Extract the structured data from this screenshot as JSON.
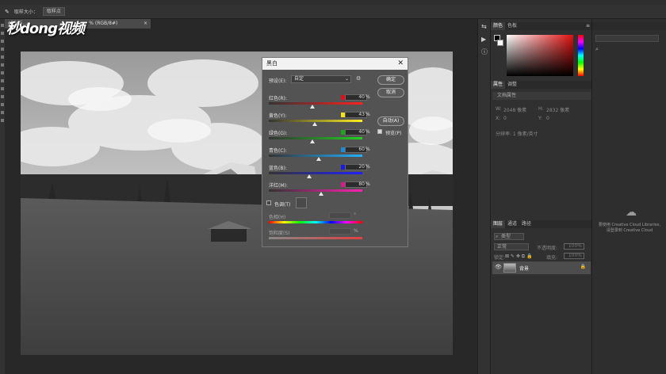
{
  "options_bar": {
    "size_label": "取样大小：",
    "size_value": "取样点"
  },
  "doc_tab": {
    "title": "c83d5...",
    "mode_suffix": "% (RGB/8#)"
  },
  "watermark": {
    "text": "秒dong视频"
  },
  "dialog": {
    "title": "黑白",
    "preset_label": "预设(E):",
    "preset_value": "自定",
    "ok_label": "确定",
    "cancel_label": "取消",
    "auto_label": "自动(A)",
    "preview_label": "预览(P)",
    "preview_checked": true,
    "sliders": [
      {
        "label": "红色(R):",
        "value": "40",
        "swatch": "#e0101a",
        "pos": 0.47
      },
      {
        "label": "黄色(Y):",
        "value": "43",
        "swatch": "#f2e31a",
        "pos": 0.49
      },
      {
        "label": "绿色(G):",
        "value": "40",
        "swatch": "#1aa81a",
        "pos": 0.47
      },
      {
        "label": "青色(C):",
        "value": "60",
        "swatch": "#1a8cd8",
        "pos": 0.53
      },
      {
        "label": "蓝色(B):",
        "value": "20",
        "swatch": "#1a1ae0",
        "pos": 0.43
      },
      {
        "label": "洋红(M):",
        "value": "80",
        "swatch": "#d81a8c",
        "pos": 0.56
      }
    ],
    "pct_sign": "%",
    "tint_label": "色调(T)",
    "hue_label": "色相(H)",
    "hue_unit": "°",
    "saturation_label": "饱和度(S)"
  },
  "color_panel": {
    "tab1": "颜色",
    "tab2": "色板"
  },
  "properties_panel": {
    "tab1": "属性",
    "tab2": "调整",
    "doc_props": "文档属性",
    "w_label": "W:",
    "w_value": "2048 像素",
    "h_label": "H:",
    "h_value": "2832 像素",
    "x_label": "X:",
    "x_value": "0",
    "y_label": "Y:",
    "y_value": "0",
    "resolution": "分辨率: 1 像素/英寸"
  },
  "layers_panel": {
    "tab1": "图层",
    "tab2": "通道",
    "tab3": "路径",
    "kind": "类型",
    "blend_mode": "正常",
    "opacity_label": "不透明度:",
    "opacity_value": "100%",
    "lock_label": "锁定:",
    "fill_label": "填充:",
    "fill_value": "100%",
    "layer_name": "背景"
  },
  "libraries": {
    "message_line1": "要使用 Creative Cloud Libraries,",
    "message_line2": "请登录到 Creative Cloud"
  },
  "colors": {
    "accent_red": "#e01010",
    "dialog_bg": "#535353",
    "panel_bg": "#303030"
  }
}
